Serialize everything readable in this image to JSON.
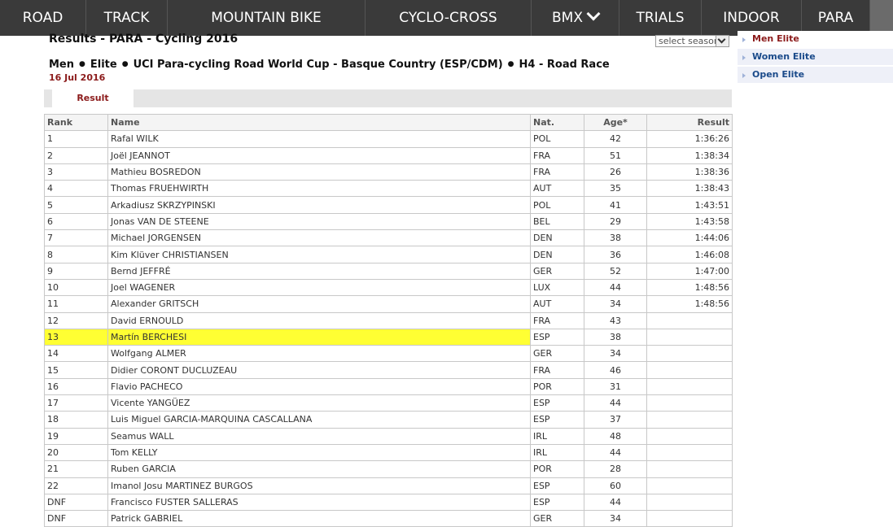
{
  "nav": {
    "items": [
      {
        "label": "ROAD"
      },
      {
        "label": "TRACK"
      },
      {
        "label": "MOUNTAIN BIKE"
      },
      {
        "label": "CYCLO-CROSS"
      },
      {
        "label": "BMX",
        "has_dropdown": true
      },
      {
        "label": "TRIALS"
      },
      {
        "label": "INDOOR"
      },
      {
        "label": "PARA",
        "active": true
      }
    ],
    "active_underline_color": "#2aa8d8"
  },
  "page": {
    "title": "Results - PARA - Cycling 2016",
    "season_select": {
      "value": "select season"
    },
    "race": {
      "gender": "Men",
      "category": "Elite",
      "event": "UCI Para-cycling Road World Cup - Basque Country (ESP/CDM)",
      "race": "H4 - Road Race",
      "separator": "●",
      "date": "16 Jul 2016"
    },
    "tabs": [
      {
        "label": "Result",
        "active": true
      }
    ]
  },
  "categories": [
    {
      "label": "Men Elite",
      "active": true
    },
    {
      "label": "Women Elite"
    },
    {
      "label": "Open Elite"
    }
  ],
  "table": {
    "headers": {
      "rank": "Rank",
      "name": "Name",
      "nat": "Nat.",
      "age": "Age*",
      "result": "Result"
    },
    "highlight_color": "#ffff33",
    "rows": [
      {
        "rank": "1",
        "name": "Rafal WILK",
        "nat": "POL",
        "age": "42",
        "result": "1:36:26"
      },
      {
        "rank": "2",
        "name": "Joël JEANNOT",
        "nat": "FRA",
        "age": "51",
        "result": "1:38:34"
      },
      {
        "rank": "3",
        "name": "Mathieu BOSREDON",
        "nat": "FRA",
        "age": "26",
        "result": "1:38:36"
      },
      {
        "rank": "4",
        "name": "Thomas FRUEHWIRTH",
        "nat": "AUT",
        "age": "35",
        "result": "1:38:43"
      },
      {
        "rank": "5",
        "name": "Arkadiusz SKRZYPINSKI",
        "nat": "POL",
        "age": "41",
        "result": "1:43:51"
      },
      {
        "rank": "6",
        "name": "Jonas VAN DE STEENE",
        "nat": "BEL",
        "age": "29",
        "result": "1:43:58"
      },
      {
        "rank": "7",
        "name": "Michael JORGENSEN",
        "nat": "DEN",
        "age": "38",
        "result": "1:44:06"
      },
      {
        "rank": "8",
        "name": "Kim Klüver CHRISTIANSEN",
        "nat": "DEN",
        "age": "36",
        "result": "1:46:08"
      },
      {
        "rank": "9",
        "name": "Bernd JEFFRÉ",
        "nat": "GER",
        "age": "52",
        "result": "1:47:00"
      },
      {
        "rank": "10",
        "name": "Joel WAGENER",
        "nat": "LUX",
        "age": "44",
        "result": "1:48:56"
      },
      {
        "rank": "11",
        "name": "Alexander GRITSCH",
        "nat": "AUT",
        "age": "34",
        "result": "1:48:56"
      },
      {
        "rank": "12",
        "name": "David ERNOULD",
        "nat": "FRA",
        "age": "43",
        "result": ""
      },
      {
        "rank": "13",
        "name": "Martín BERCHESI",
        "nat": "ESP",
        "age": "38",
        "result": "",
        "highlighted": true
      },
      {
        "rank": "14",
        "name": "Wolfgang ALMER",
        "nat": "GER",
        "age": "34",
        "result": ""
      },
      {
        "rank": "15",
        "name": "Didier CORONT DUCLUZEAU",
        "nat": "FRA",
        "age": "46",
        "result": ""
      },
      {
        "rank": "16",
        "name": "Flavio PACHECO",
        "nat": "POR",
        "age": "31",
        "result": ""
      },
      {
        "rank": "17",
        "name": "Vicente YANGÜEZ",
        "nat": "ESP",
        "age": "44",
        "result": ""
      },
      {
        "rank": "18",
        "name": "Luis Miguel GARCIA-MARQUINA CASCALLANA",
        "nat": "ESP",
        "age": "37",
        "result": ""
      },
      {
        "rank": "19",
        "name": "Seamus WALL",
        "nat": "IRL",
        "age": "48",
        "result": ""
      },
      {
        "rank": "20",
        "name": "Tom KELLY",
        "nat": "IRL",
        "age": "44",
        "result": ""
      },
      {
        "rank": "21",
        "name": "Ruben GARCIA",
        "nat": "POR",
        "age": "28",
        "result": ""
      },
      {
        "rank": "22",
        "name": "Imanol Josu MARTINEZ BURGOS",
        "nat": "ESP",
        "age": "60",
        "result": ""
      },
      {
        "rank": "DNF",
        "name": "Francisco FUSTER SALLERAS",
        "nat": "ESP",
        "age": "44",
        "result": ""
      },
      {
        "rank": "DNF",
        "name": "Patrick GABRIEL",
        "nat": "GER",
        "age": "34",
        "result": ""
      }
    ]
  }
}
